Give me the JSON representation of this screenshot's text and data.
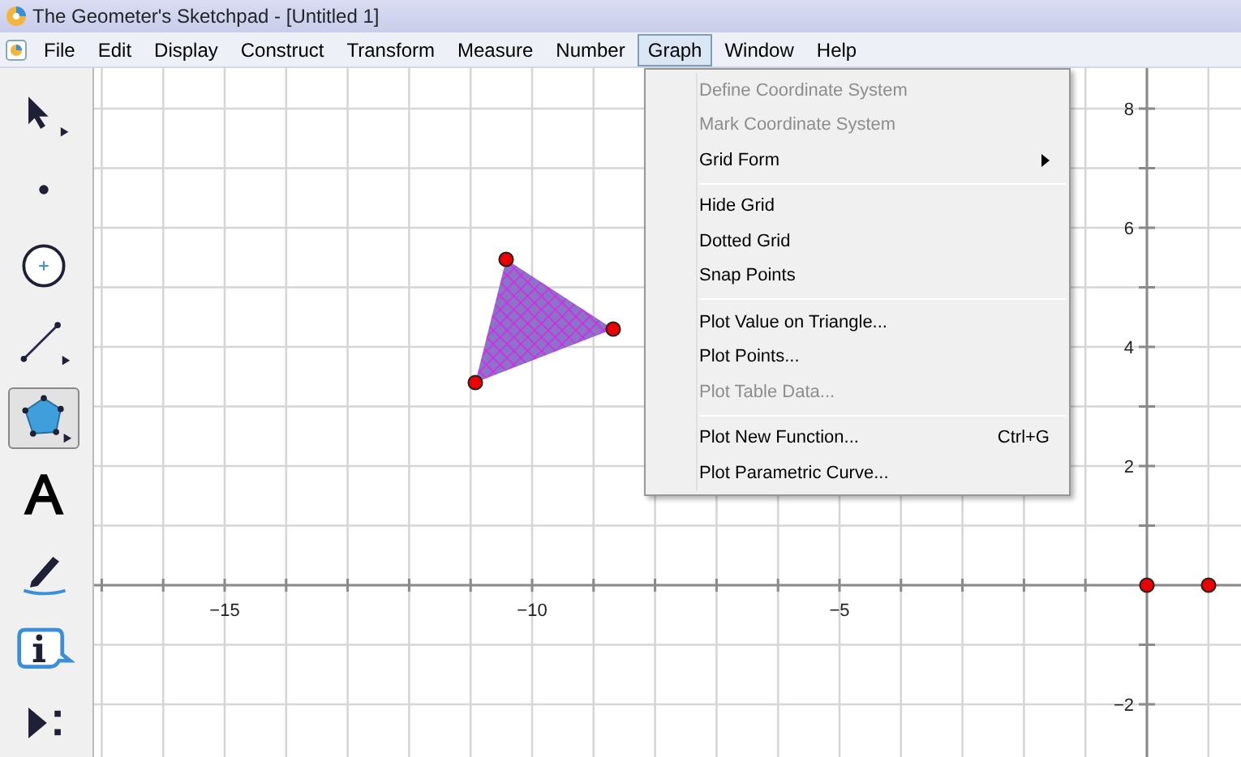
{
  "window": {
    "title": "The Geometer's Sketchpad - [Untitled 1]"
  },
  "menu_bar": [
    {
      "label": "File",
      "selected": false
    },
    {
      "label": "Edit",
      "selected": false
    },
    {
      "label": "Display",
      "selected": false
    },
    {
      "label": "Construct",
      "selected": false
    },
    {
      "label": "Transform",
      "selected": false
    },
    {
      "label": "Measure",
      "selected": false
    },
    {
      "label": "Number",
      "selected": false
    },
    {
      "label": "Graph",
      "selected": true
    },
    {
      "label": "Window",
      "selected": false
    },
    {
      "label": "Help",
      "selected": false
    }
  ],
  "toolbar": [
    {
      "kind": "arrow",
      "selected": false
    },
    {
      "kind": "point",
      "selected": false
    },
    {
      "kind": "compass",
      "selected": false
    },
    {
      "kind": "line",
      "selected": false
    },
    {
      "kind": "polygon",
      "selected": true
    },
    {
      "kind": "text",
      "selected": false
    },
    {
      "kind": "marker",
      "selected": false
    },
    {
      "kind": "info",
      "selected": false
    },
    {
      "kind": "custom",
      "selected": false
    }
  ],
  "graph_menu": [
    {
      "kind": "item",
      "label": "Define Coordinate System",
      "disabled": true
    },
    {
      "kind": "item",
      "label": "Mark Coordinate System",
      "disabled": true
    },
    {
      "kind": "item",
      "label": "Grid Form",
      "disabled": false,
      "submenu": true
    },
    {
      "kind": "separator"
    },
    {
      "kind": "item",
      "label": "Hide Grid",
      "disabled": false
    },
    {
      "kind": "item",
      "label": "Dotted Grid",
      "disabled": false
    },
    {
      "kind": "item",
      "label": "Snap Points",
      "disabled": false
    },
    {
      "kind": "separator"
    },
    {
      "kind": "item",
      "label": "Plot Value on Triangle...",
      "disabled": false
    },
    {
      "kind": "item",
      "label": "Plot Points...",
      "disabled": false
    },
    {
      "kind": "item",
      "label": "Plot Table Data...",
      "disabled": true
    },
    {
      "kind": "separator"
    },
    {
      "kind": "item",
      "label": "Plot New Function...",
      "disabled": false,
      "shortcut": "Ctrl+G"
    },
    {
      "kind": "item",
      "label": "Plot Parametric Curve...",
      "disabled": false
    }
  ],
  "canvas": {
    "x_labels": [
      "−15",
      "−10",
      "−5"
    ],
    "y_labels": [
      "8",
      "6",
      "4",
      "2",
      "−2"
    ]
  }
}
